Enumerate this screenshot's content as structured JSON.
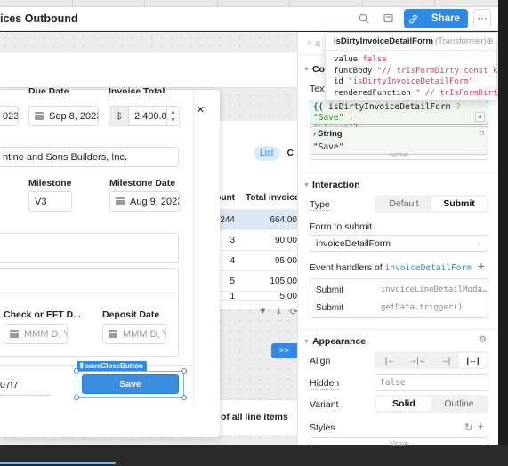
{
  "tabstrip": {
    "tabs": [
      "",
      "",
      "",
      "",
      "",
      "",
      ""
    ]
  },
  "header": {
    "title": "ices Outbound",
    "share_label": "Share",
    "more_label": "···"
  },
  "background": {
    "view_toggle": {
      "list_label": "List",
      "other_label": "C"
    },
    "table": {
      "headers": [
        "count",
        "Total invoice"
      ],
      "rows": [
        [
          "244",
          "664,00"
        ],
        [
          "3",
          "90,00"
        ],
        [
          "4",
          "95,00"
        ],
        [
          "5",
          "105,00"
        ],
        [
          "1",
          "5,00"
        ]
      ]
    },
    "pager_label": ">>",
    "footer_text": "of all line items"
  },
  "modal": {
    "close_label": "×",
    "invoice_date_value": "023",
    "due_date_label": "Due Date",
    "due_date_value": "Sep 8, 2023",
    "invoice_total_label": "Invoice Total",
    "currency_symbol": "$",
    "invoice_total_value": "2,400.00",
    "customer_value": "ntine and Sons Builders, Inc.",
    "milestone_label": "Milestone",
    "milestone_value": "V3",
    "milestone_date_label": "Milestone Date",
    "milestone_date_value": "Aug 9, 2023",
    "check_label": "Check or EFT D...",
    "check_placeholder": "MMM D, YY",
    "deposit_label": "Deposit Date",
    "deposit_placeholder": "MMM D, YY",
    "hex_text": "07f7",
    "selected_component_tag": "saveCloseButton",
    "save_button_label": "Save"
  },
  "tooltip": {
    "name": "isDirtyInvoiceDetailForm",
    "kind": "(Transformer)",
    "rows": [
      {
        "key": "value",
        "value": "false"
      },
      {
        "key": "funcBody",
        "value": "\"// trIsFormDirty const k…"
      },
      {
        "key": "id",
        "value": "\"isDirtyInvoiceDetailForm\""
      },
      {
        "key": "renderedFunction",
        "value": "\" // trIsFormDirt…"
      }
    ]
  },
  "inspector": {
    "search_placeholder": "s",
    "content_section": "Cont",
    "text_label": "Text",
    "text_code": {
      "open": "{{ ",
      "var": "isDirtyInvoiceDetailForm",
      "q": " ? ",
      "a": "\"Save\"",
      "colon": " :",
      "b": "\"Close\"",
      "close": "}}"
    },
    "result_type": "String",
    "result_value": "\"Save\"",
    "none_label": "None",
    "interaction_section": "Interaction",
    "type_label": "Type",
    "type_options": [
      "Default",
      "Submit"
    ],
    "type_selected": "Submit",
    "form_to_submit_label": "Form to submit",
    "form_to_submit_value": "invoiceDetailForm",
    "event_handlers_label": "Event handlers of",
    "event_handlers_target": "invoiceDetailForm",
    "handlers": [
      {
        "event": "Submit",
        "action": "invoiceLineDetailModa…"
      },
      {
        "event": "Submit",
        "action": "getData.trigger()"
      }
    ],
    "appearance_section": "Appearance",
    "align_label": "Align",
    "align_options": [
      "|←",
      "→|←",
      "→|",
      "|↔|"
    ],
    "align_selected": "|↔|",
    "hidden_label": "Hidden",
    "hidden_value": "false",
    "variant_label": "Variant",
    "variant_options": [
      "Solid",
      "Outline"
    ],
    "variant_selected": "Solid",
    "styles_label": "Styles",
    "styles_none": "None"
  },
  "colors": {
    "accent": "#2f8ae5",
    "code_green": "#2d8a2d",
    "code_pink": "#d13b6b"
  }
}
